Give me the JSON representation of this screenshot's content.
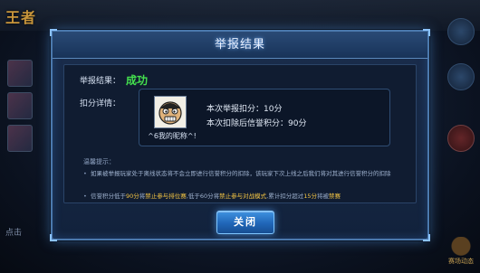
{
  "background": {
    "logo_text": "王者",
    "bottom_left_text": "点击",
    "bottom_right_text": "赛场动态"
  },
  "dialog": {
    "title": "举报结果",
    "result_label": "举报结果：",
    "result_value": "成功",
    "detail_label": "扣分详情：",
    "player_name": "^6我的昵称^!",
    "report_deduction": "本次举报扣分：10分",
    "credit_after": "本次扣除后信誉积分：90分",
    "tips_title": "温馨提示：",
    "tip1": "如果被举报玩家处于离线状态将不会立即进行信誉积分的扣除，该玩家下次上线之后我们将对其进行信誉积分的扣除",
    "tip2": {
      "part1": "信誉积分低于",
      "v1": "90分",
      "part2": "将",
      "v2": "禁止参与排位赛",
      "part3": ",低于60分将",
      "v3": "禁止参与对战模式",
      "part4": ",累计扣分超过",
      "v4": "15分",
      "part5": "将被",
      "v5": "禁赛"
    },
    "close_label": "关闭"
  },
  "colors": {
    "success": "#44e04e",
    "highlight": "#f3c444",
    "frame": "#4b79ad"
  },
  "icons": [
    "player-cartoon-face-icon"
  ]
}
